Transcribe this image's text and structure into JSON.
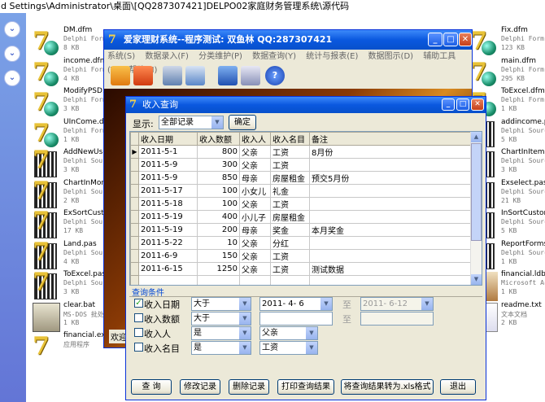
{
  "pathbar": "d Settings\\Administrator\\桌面\\[QQ287307421]DELPO02家庭财务管理系统\\源代码",
  "taskpane": {
    "icons": [
      "chevron-down-icon",
      "chevron-down-icon",
      "chevron-down-icon"
    ]
  },
  "files_left": [
    {
      "name": "DM.dfm",
      "type": "Delphi Form",
      "size": "8 KB",
      "icon": "delphi-form-icon"
    },
    {
      "name": "income.dfm",
      "type": "Delphi Form",
      "size": "4 KB",
      "icon": "delphi-form-icon"
    },
    {
      "name": "ModifyPSD.d",
      "type": "Delphi Form",
      "size": "3 KB",
      "icon": "delphi-form-icon"
    },
    {
      "name": "UInCome.dfm",
      "type": "Delphi Form",
      "size": "1 KB",
      "icon": "delphi-form-icon"
    },
    {
      "name": "AddNewUser.",
      "type": "Delphi Sourc",
      "size": "3 KB",
      "icon": "delphi-source-icon"
    },
    {
      "name": "ChartInMont",
      "type": "Delphi Sourc",
      "size": "2 KB",
      "icon": "delphi-source-icon"
    },
    {
      "name": "ExSortCusto",
      "type": "Delphi Sourc",
      "size": "17 KB",
      "icon": "delphi-source-icon"
    },
    {
      "name": "Land.pas",
      "type": "Delphi Sourc",
      "size": "4 KB",
      "icon": "delphi-source-icon"
    },
    {
      "name": "ToExcel.pas",
      "type": "Delphi Sourc",
      "size": "3 KB",
      "icon": "delphi-source-icon"
    },
    {
      "name": "clear.bat",
      "type": "MS-DOS 批处理文件",
      "size": "1 KB",
      "icon": "batch-file-icon"
    },
    {
      "name": "financial.exe",
      "type": "应用程序",
      "size": "",
      "icon": "app-exe-icon"
    }
  ],
  "files_right": [
    {
      "name": "Fix.dfm",
      "type": "Delphi Form",
      "size": "123 KB",
      "icon": "delphi-form-icon"
    },
    {
      "name": "main.dfm",
      "type": "Delphi Form",
      "size": "295 KB",
      "icon": "delphi-form-icon"
    },
    {
      "name": "ToExcel.dfm",
      "type": "Delphi Form",
      "size": "1 KB",
      "icon": "delphi-form-icon"
    },
    {
      "name": "addincome.pas",
      "type": "Delphi Sourc",
      "size": "5 KB",
      "icon": "delphi-source-icon"
    },
    {
      "name": "ChartInItem.p",
      "type": "Delphi Sourc",
      "size": "3 KB",
      "icon": "delphi-source-icon"
    },
    {
      "name": "Exselect.pas",
      "type": "Delphi Sourc",
      "size": "21 KB",
      "icon": "delphi-source-icon"
    },
    {
      "name": "InSortCustom.",
      "type": "Delphi Sourc",
      "size": "5 KB",
      "icon": "delphi-source-icon"
    },
    {
      "name": "ReportForms.pa",
      "type": "Delphi Sourc",
      "size": "1 KB",
      "icon": "delphi-source-icon"
    },
    {
      "name": "financial.ldb",
      "type": "Microsoft Acce",
      "size": "1 KB",
      "icon": "access-db-icon"
    },
    {
      "name": "readme.txt",
      "type": "文本文档",
      "size": "2 KB",
      "icon": "text-file-icon"
    }
  ],
  "main_window": {
    "title": "爱家理财系统--程序测试: 双鱼林 QQ:287307421",
    "menu": [
      "系统(S)",
      "数据录入(F)",
      "分类维护(P)",
      "数据查询(Y)",
      "统计与报表(E)",
      "数据图示(D)",
      "辅助工具(T)",
      "帮助(H)"
    ],
    "toolbar_icons": [
      "add-record-icon",
      "rss-feed-icon",
      "monitor-search-icon",
      "monitor-chart-icon",
      "book-icon",
      "calculator-icon",
      "help-icon"
    ],
    "status_fragment": "欢迎"
  },
  "dialog": {
    "title": "收入查询",
    "show_label": "显示:",
    "show_value": "全部记录",
    "confirm_button": "确定",
    "columns": [
      "收入日期",
      "收入数额",
      "收入人",
      "收入名目",
      "备注"
    ],
    "rows": [
      [
        "2011-5-1",
        "800",
        "父亲",
        "工资",
        "8月份"
      ],
      [
        "2011-5-9",
        "300",
        "父亲",
        "工资",
        ""
      ],
      [
        "2011-5-9",
        "850",
        "母亲",
        "房屋租金",
        "预交5月份"
      ],
      [
        "2011-5-17",
        "100",
        "小女儿",
        "礼金",
        ""
      ],
      [
        "2011-5-18",
        "100",
        "父亲",
        "工资",
        ""
      ],
      [
        "2011-5-19",
        "400",
        "小儿子",
        "房屋租金",
        ""
      ],
      [
        "2011-5-19",
        "200",
        "母亲",
        "奖金",
        "本月奖金"
      ],
      [
        "2011-5-22",
        "10",
        "父亲",
        "分红",
        ""
      ],
      [
        "2011-6-9",
        "150",
        "父亲",
        "工资",
        ""
      ],
      [
        "2011-6-15",
        "1250",
        "父亲",
        "工资",
        "测试数据"
      ]
    ],
    "query_title": "查询条件",
    "conditions": {
      "date": {
        "label": "收入日期",
        "checked": true,
        "op": "大于",
        "value": "2011- 4- 6",
        "to_label": "至",
        "to_value": "2011- 6-12"
      },
      "amount": {
        "label": "收入数额",
        "checked": false,
        "op": "大于",
        "value": "",
        "to_label": "至",
        "to_value": ""
      },
      "person": {
        "label": "收入人",
        "checked": false,
        "op": "是",
        "value": "父亲"
      },
      "item": {
        "label": "收入名目",
        "checked": false,
        "op": "是",
        "value": "工资"
      }
    },
    "buttons": {
      "query": "查  询",
      "modify": "修改记录",
      "delete": "删除记录",
      "print": "打印查询结果",
      "export": "将查询结果转为.xls格式",
      "exit": "退出"
    }
  }
}
